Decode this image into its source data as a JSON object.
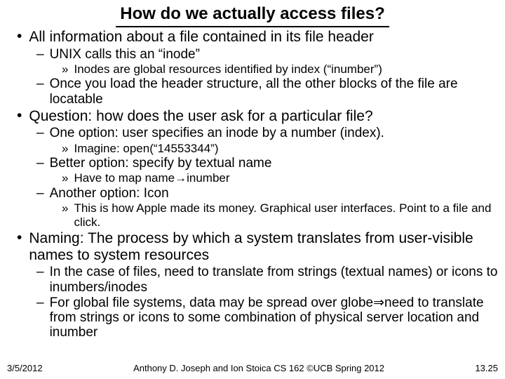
{
  "title": "How do we actually access files?",
  "b1": "All information about a file contained in its file header",
  "b1_1": "UNIX calls this an “inode”",
  "b1_1_1": "Inodes are global resources identified by index (“inumber”)",
  "b1_2": "Once you load the header structure, all the other blocks of the file are locatable",
  "b2": "Question: how does the user ask for a particular file?",
  "b2_1": "One option: user specifies an inode by a number (index).",
  "b2_1_1": "Imagine: open(“14553344”)",
  "b2_2": "Better option: specify by textual name",
  "b2_2_1": "Have to map name→inumber",
  "b2_3": "Another option: Icon",
  "b2_3_1": "This is how Apple made its money.  Graphical user interfaces. Point to a file and click.",
  "b3": "Naming: The process by which a system translates from user-visible names to system resources",
  "b3_1": "In the case of files, need to translate from strings (textual names) or icons to inumbers/inodes",
  "b3_2": "For global file systems, data may be spread over globe⇒need to translate from strings or icons to some combination of physical server location and inumber",
  "footer_date": "3/5/2012",
  "footer_credit": "Anthony D. Joseph and Ion Stoica CS 162 ©UCB Spring 2012",
  "footer_page": "13.25"
}
